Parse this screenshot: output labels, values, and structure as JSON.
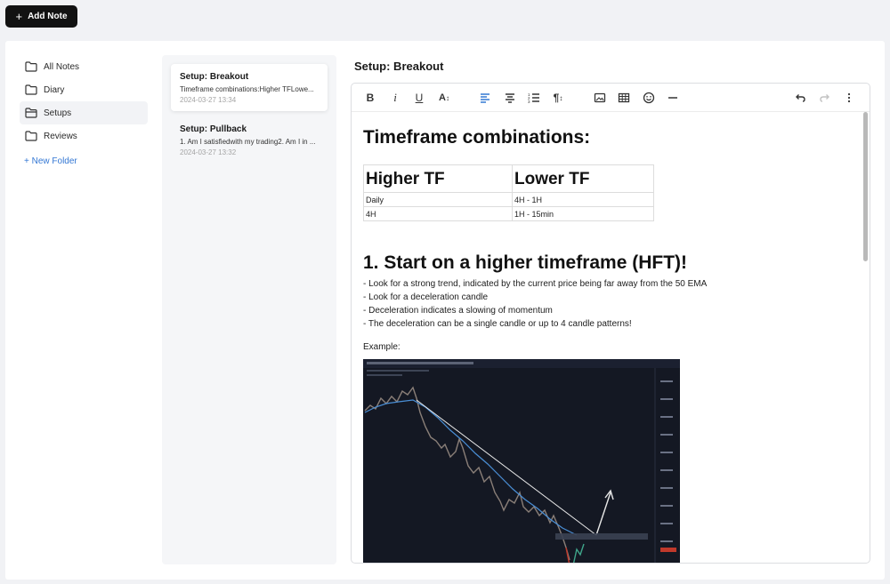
{
  "header": {
    "add_note_label": "Add Note"
  },
  "folders": {
    "items": [
      {
        "label": "All Notes",
        "icon": "folder-icon"
      },
      {
        "label": "Diary",
        "icon": "folder-icon"
      },
      {
        "label": "Setups",
        "icon": "folder-open-icon",
        "active": true
      },
      {
        "label": "Reviews",
        "icon": "folder-icon"
      }
    ],
    "new_folder_label": "+ New Folder"
  },
  "notes": [
    {
      "title": "Setup: Breakout",
      "preview": "Timeframe combinations:Higher TFLowe...",
      "date": "2024-03-27 13:34",
      "active": true
    },
    {
      "title": "Setup: Pullback",
      "preview": "1. Am I satisfiedwith my trading2. Am I in ...",
      "date": "2024-03-27 13:32"
    }
  ],
  "editor": {
    "title": "Setup: Breakout",
    "heading1": "Timeframe combinations:",
    "table": {
      "headers": [
        "Higher TF",
        "Lower TF"
      ],
      "rows": [
        [
          "Daily",
          "4H - 1H"
        ],
        [
          "4H",
          "1H - 15min"
        ]
      ]
    },
    "heading2": "1. Start on a higher timeframe (HFT)!",
    "bullets": [
      "- Look for a strong trend, indicated by the current price being far away from the 50 EMA",
      "- Look for a deceleration candle",
      "- Deceleration indicates a slowing of momentum",
      "- The deceleration can be a single candle or up to 4 candle patterns!"
    ],
    "example_label": "Example:"
  },
  "colors": {
    "accent": "#3478d4",
    "button_dark": "#121212",
    "chart_bg": "#141823"
  }
}
